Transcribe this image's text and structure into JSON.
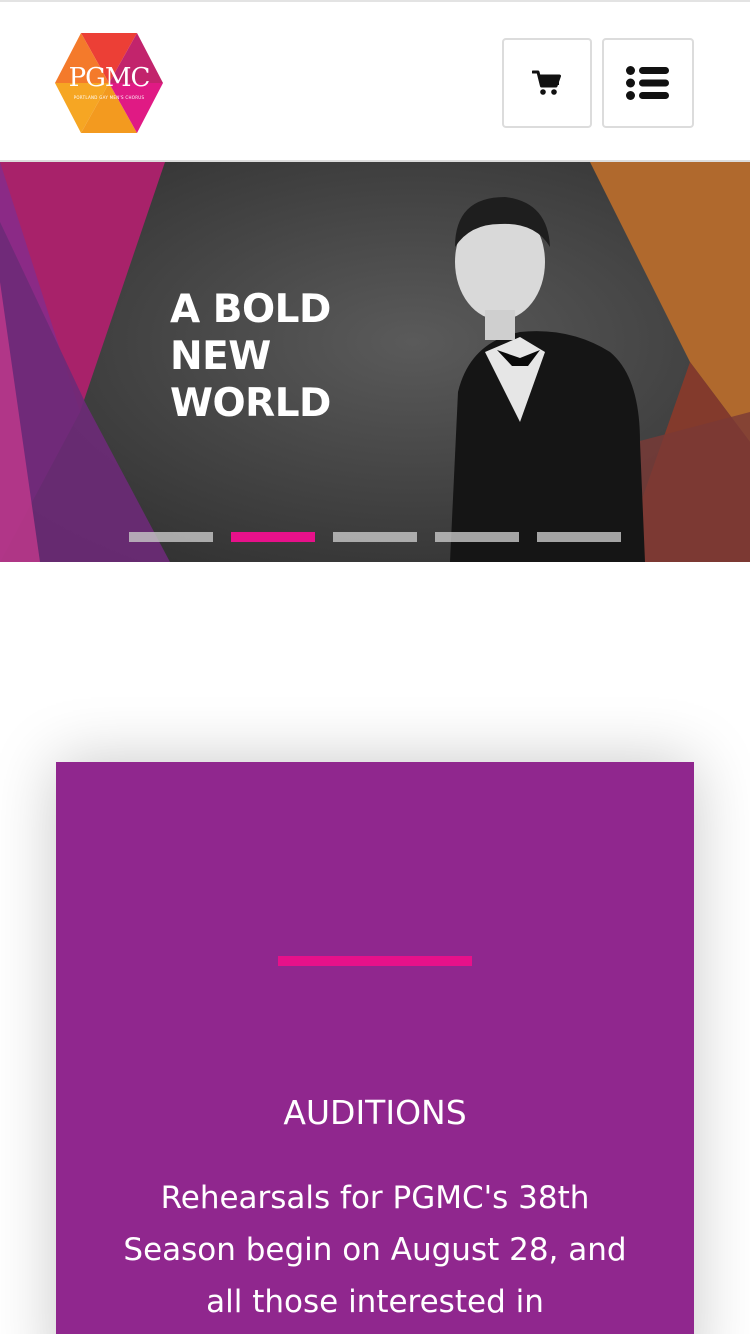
{
  "header": {
    "logo": {
      "text": "PGMC",
      "tagline": "PORTLAND GAY MEN'S CHORUS",
      "colors": [
        "#e8412d",
        "#f39a1f",
        "#e01a84",
        "#8e2a8e",
        "#f6c23e"
      ]
    },
    "cart_icon": "shopping-cart-icon",
    "menu_icon": "list-menu-icon"
  },
  "hero": {
    "title": "A BOLD NEW WORLD",
    "slides_count": 5,
    "active_slide_index": 1,
    "colors": {
      "magenta": "#b4206f",
      "purple": "#8b2a86",
      "orange": "#b26a2d",
      "dark": "#3a3a3a"
    }
  },
  "card": {
    "title": "AUDITIONS",
    "text": "Rehearsals for PGMC's 38th Season begin on August 28, and all those interested in",
    "background": "#90278e",
    "accent": "#e7118a"
  }
}
